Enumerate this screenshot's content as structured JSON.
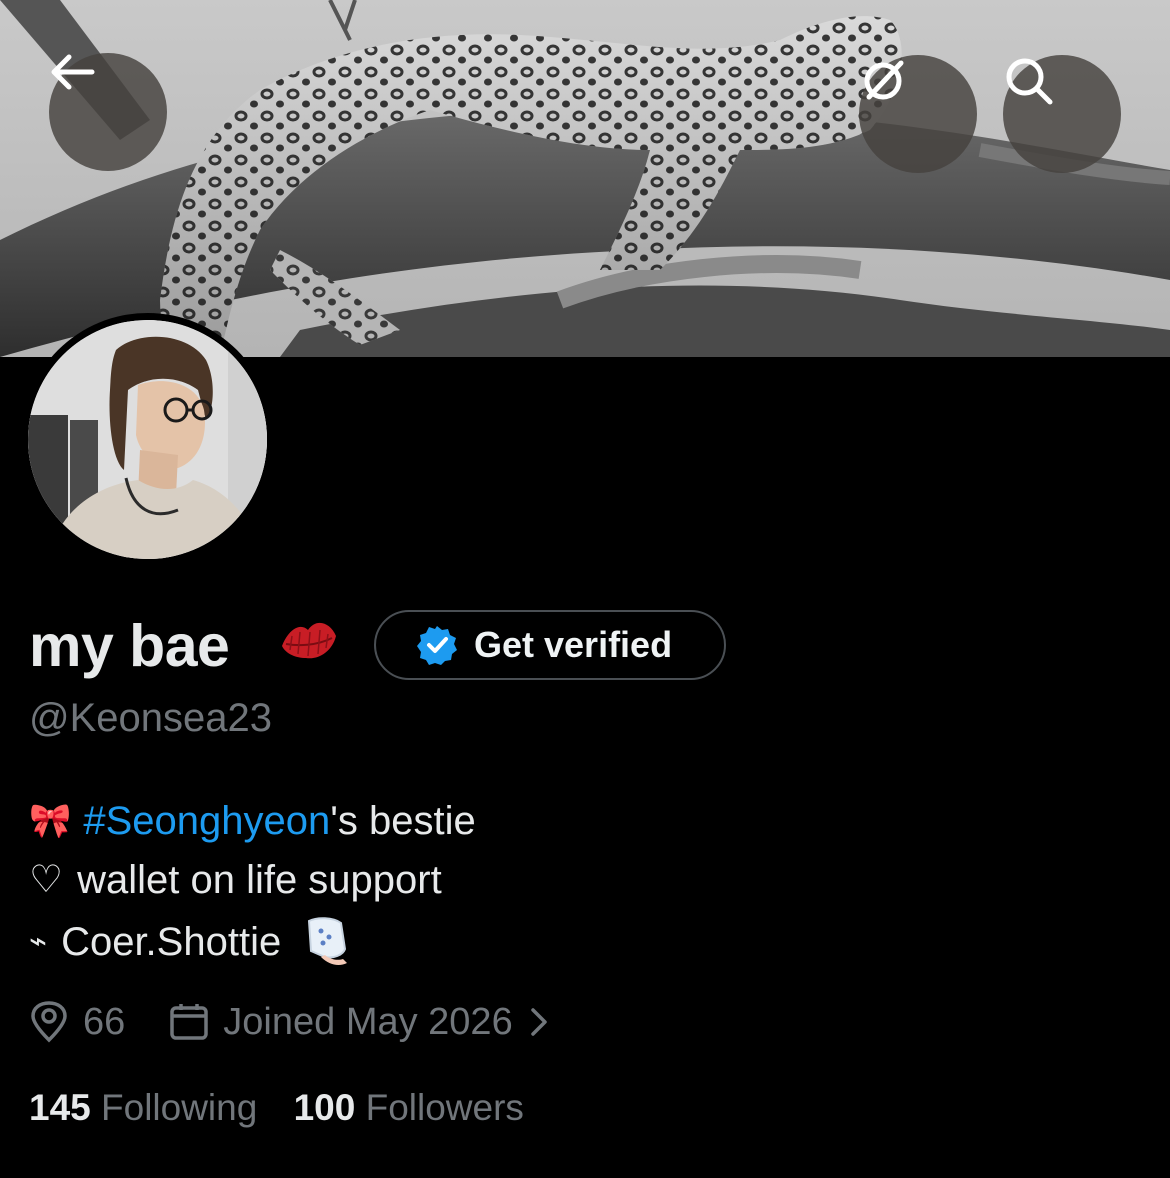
{
  "header": {
    "back_icon": "arrow-left-icon",
    "grok_icon": "grok-icon",
    "search_icon": "search-icon"
  },
  "profile": {
    "display_name": "my bae",
    "name_emoji": "kiss-mark-emoji",
    "handle": "@Keonsea23",
    "verify_label": "Get verified",
    "verify_color": "#1d9bf0"
  },
  "bio": {
    "line1_prefix": "🎀",
    "line1_hashtag": "#Seonghyeon",
    "line1_suffix": "'s bestie",
    "line2_prefix": "♡",
    "line2_text": "wallet on life support",
    "line3_prefix": "⌁",
    "line3_text": "Coer.Shottie"
  },
  "meta": {
    "location": "66",
    "joined": "Joined May 2026"
  },
  "stats": {
    "following_count": "145",
    "following_label": "Following",
    "followers_count": "100",
    "followers_label": "Followers"
  },
  "colors": {
    "background": "#000000",
    "text_primary": "#e7e9ea",
    "text_secondary": "#71767b",
    "accent": "#1d9bf0"
  }
}
